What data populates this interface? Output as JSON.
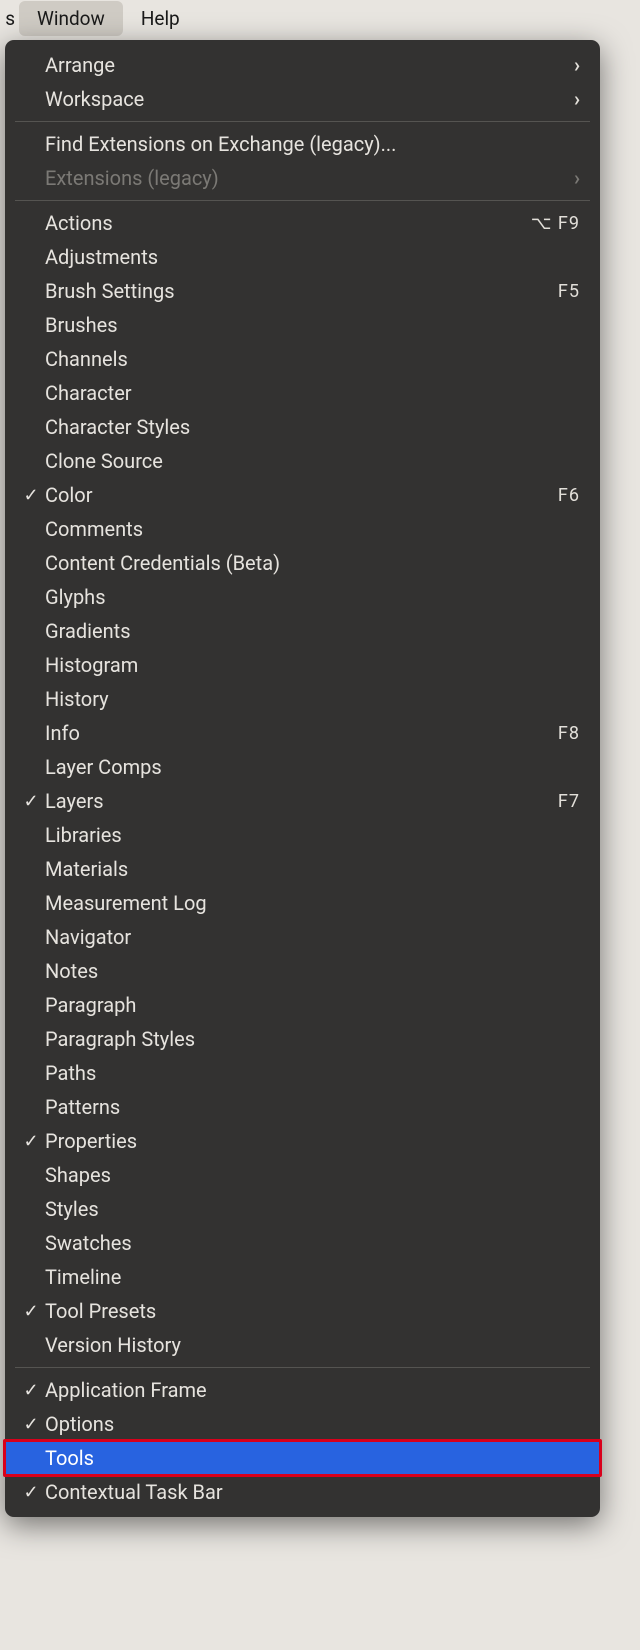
{
  "menubar": {
    "partial_prev": "s",
    "window": "Window",
    "help": "Help"
  },
  "menu": {
    "section1": [
      {
        "label": "Arrange",
        "submenu": true,
        "checked": false,
        "disabled": false
      },
      {
        "label": "Workspace",
        "submenu": true,
        "checked": false,
        "disabled": false
      }
    ],
    "section2": [
      {
        "label": "Find Extensions on Exchange (legacy)...",
        "submenu": false,
        "checked": false,
        "disabled": false
      },
      {
        "label": "Extensions (legacy)",
        "submenu": true,
        "checked": false,
        "disabled": true
      }
    ],
    "section3": [
      {
        "label": "Actions",
        "shortcut": "⌥ F9"
      },
      {
        "label": "Adjustments"
      },
      {
        "label": "Brush Settings",
        "shortcut": "F5"
      },
      {
        "label": "Brushes"
      },
      {
        "label": "Channels"
      },
      {
        "label": "Character"
      },
      {
        "label": "Character Styles"
      },
      {
        "label": "Clone Source"
      },
      {
        "label": "Color",
        "shortcut": "F6",
        "checked": true
      },
      {
        "label": "Comments"
      },
      {
        "label": "Content Credentials (Beta)"
      },
      {
        "label": "Glyphs"
      },
      {
        "label": "Gradients"
      },
      {
        "label": "Histogram"
      },
      {
        "label": "History"
      },
      {
        "label": "Info",
        "shortcut": "F8"
      },
      {
        "label": "Layer Comps"
      },
      {
        "label": "Layers",
        "shortcut": "F7",
        "checked": true
      },
      {
        "label": "Libraries"
      },
      {
        "label": "Materials"
      },
      {
        "label": "Measurement Log"
      },
      {
        "label": "Navigator"
      },
      {
        "label": "Notes"
      },
      {
        "label": "Paragraph"
      },
      {
        "label": "Paragraph Styles"
      },
      {
        "label": "Paths"
      },
      {
        "label": "Patterns"
      },
      {
        "label": "Properties",
        "checked": true
      },
      {
        "label": "Shapes"
      },
      {
        "label": "Styles"
      },
      {
        "label": "Swatches"
      },
      {
        "label": "Timeline"
      },
      {
        "label": "Tool Presets",
        "checked": true
      },
      {
        "label": "Version History"
      }
    ],
    "section4": [
      {
        "label": "Application Frame",
        "checked": true
      },
      {
        "label": "Options",
        "checked": true
      },
      {
        "label": "Tools",
        "checked": false,
        "highlighted": true
      },
      {
        "label": "Contextual Task Bar",
        "checked": true
      }
    ]
  }
}
